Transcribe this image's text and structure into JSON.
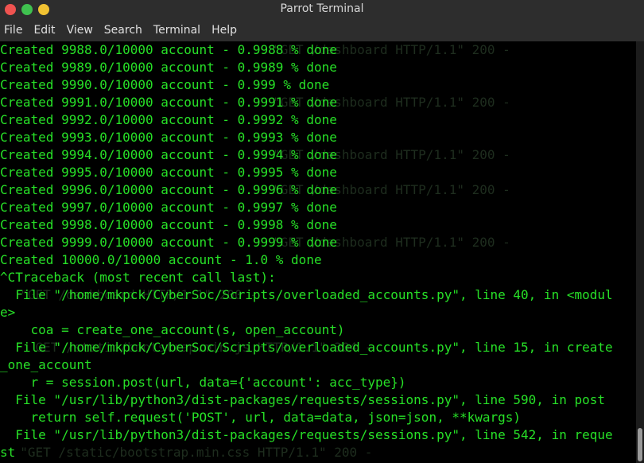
{
  "window": {
    "title": "Parrot Terminal"
  },
  "menu": [
    "File",
    "Edit",
    "View",
    "Search",
    "Terminal",
    "Help"
  ],
  "background_lines": [
    "                                   \"GET /dashboard HTTP/1.1\" 200 -",
    "",
    "",
    "                                   \"GET /dashboard HTTP/1.1\" 200 -",
    "",
    "",
    "                                   \"GET /dashboard HTTP/1.1\" 200 -",
    "",
    "                                   \"GET /dashboard HTTP/1.1\" 200 -",
    "",
    "",
    "                                   \"GET /dashboard HTTP/1.1\" 200 -",
    "",
    "",
    "  \"GET /dashboard HTTP/1.1\" 200 -",
    "",
    "",
    "    GET /static/bootstrap.min.js HTTP/1.1\" 304 -",
    "",
    "",
    "",
    "",
    "",
    "  \"GET /static/bootstrap.min.css HTTP/1.1\" 200 -"
  ],
  "lines": [
    "Created 9988.0/10000 account - 0.9988 % done",
    "Created 9989.0/10000 account - 0.9989 % done",
    "Created 9990.0/10000 account - 0.999 % done",
    "Created 9991.0/10000 account - 0.9991 % done",
    "Created 9992.0/10000 account - 0.9992 % done",
    "Created 9993.0/10000 account - 0.9993 % done",
    "Created 9994.0/10000 account - 0.9994 % done",
    "Created 9995.0/10000 account - 0.9995 % done",
    "Created 9996.0/10000 account - 0.9996 % done",
    "Created 9997.0/10000 account - 0.9997 % done",
    "Created 9998.0/10000 account - 0.9998 % done",
    "Created 9999.0/10000 account - 0.9999 % done",
    "Created 10000.0/10000 account - 1.0 % done",
    "^CTraceback (most recent call last):",
    "  File \"/home/mkpck/CyberSoc/Scripts/overloaded_accounts.py\", line 40, in <modul",
    "e>",
    "    coa = create_one_account(s, open_account)",
    "  File \"/home/mkpck/CyberSoc/Scripts/overloaded_accounts.py\", line 15, in create",
    "_one_account",
    "    r = session.post(url, data={'account': acc_type})",
    "  File \"/usr/lib/python3/dist-packages/requests/sessions.py\", line 590, in post",
    "    return self.request('POST', url, data=data, json=json, **kwargs)",
    "  File \"/usr/lib/python3/dist-packages/requests/sessions.py\", line 542, in reque",
    "st"
  ]
}
